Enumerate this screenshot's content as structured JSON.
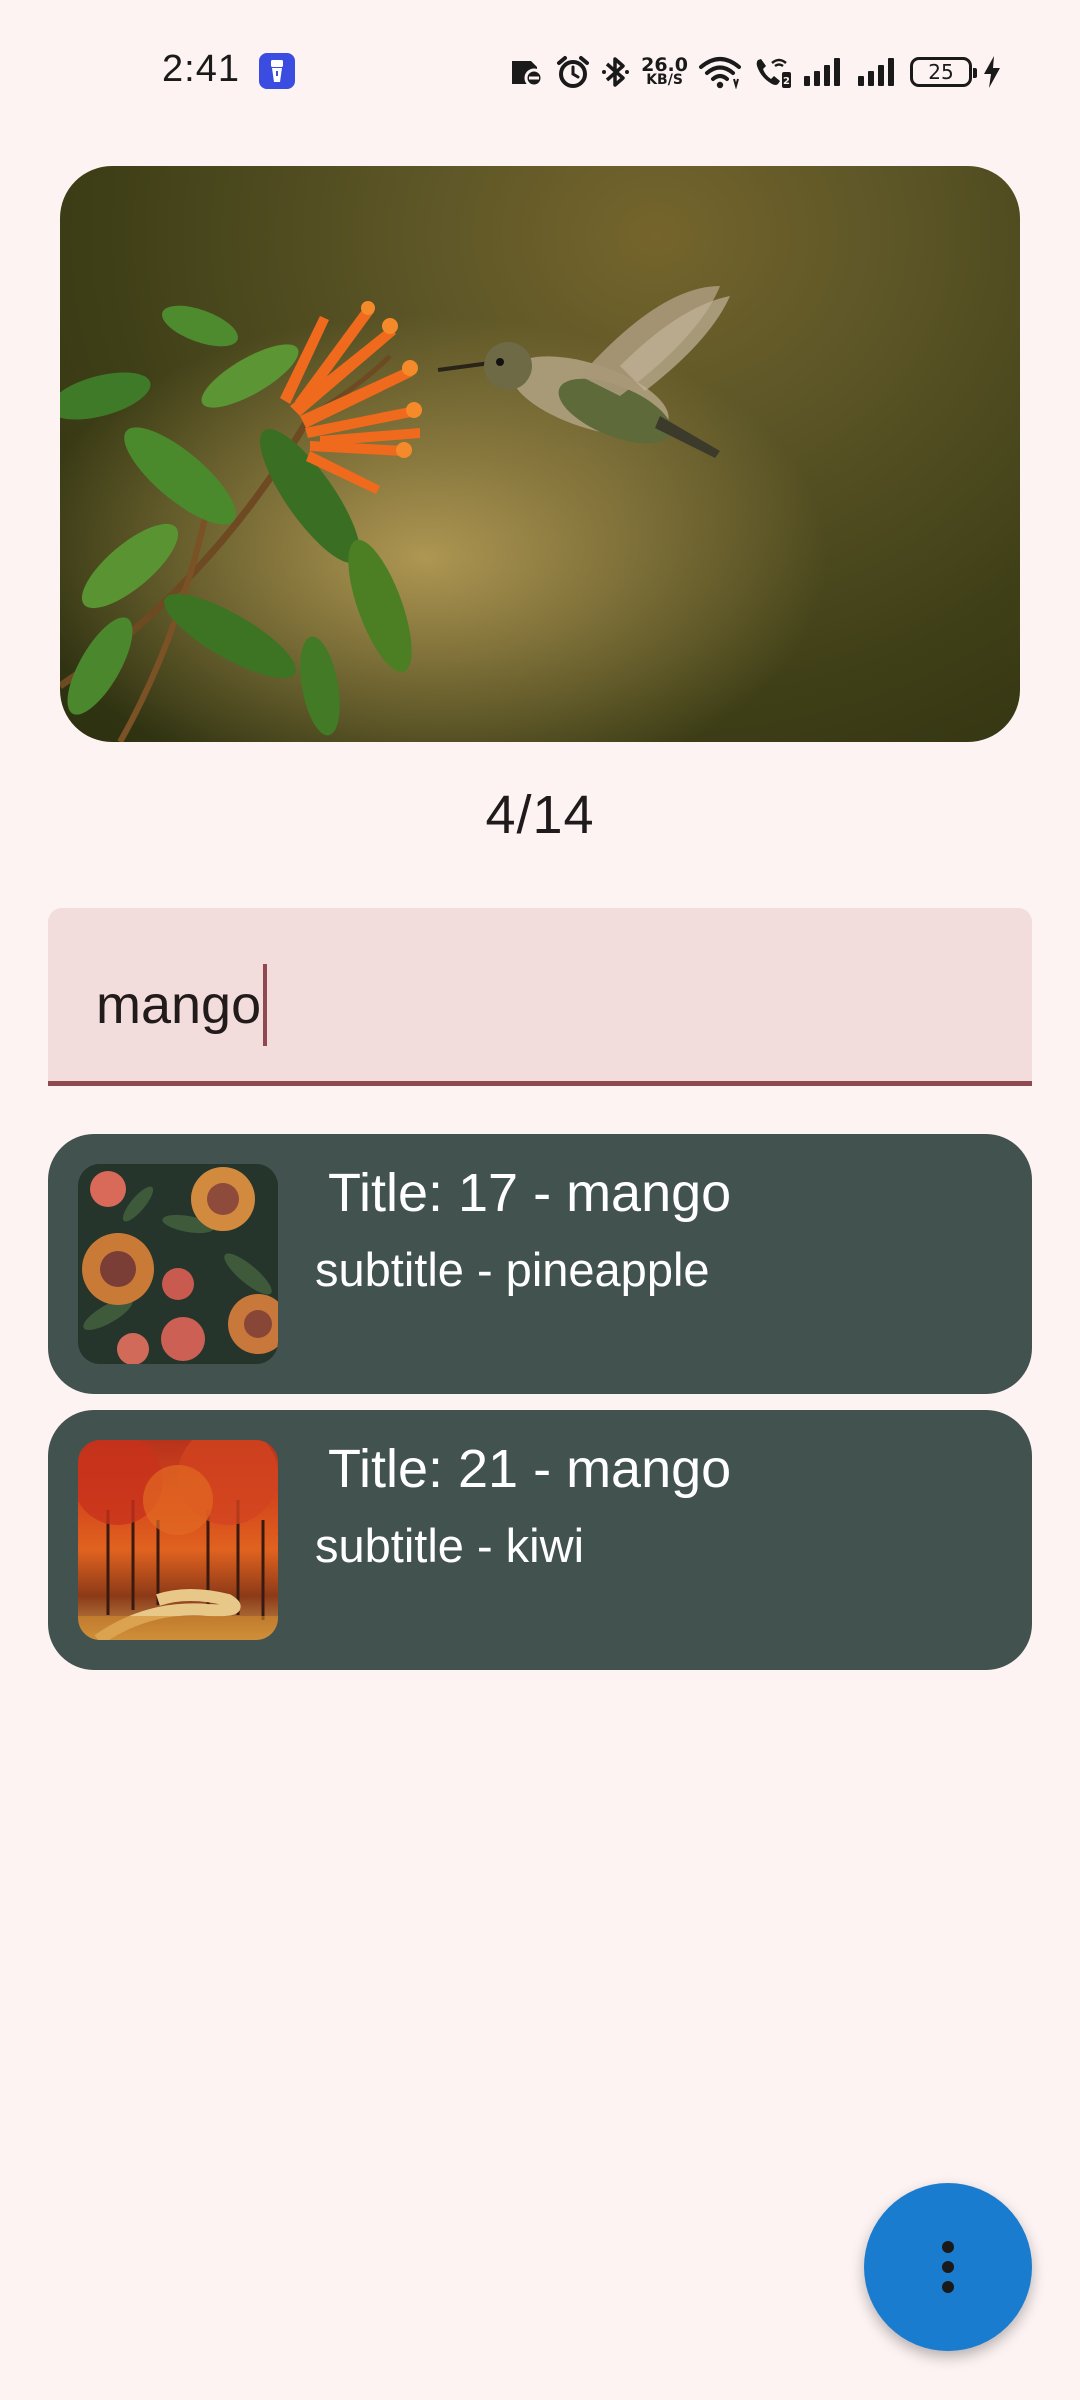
{
  "status_bar": {
    "time": "2:41",
    "net_speed_value": "26.0",
    "net_speed_unit": "KB/S",
    "battery_level": "25",
    "icons": [
      "flashlight-icon",
      "no-sim-card-icon",
      "alarm-icon",
      "bluetooth-icon",
      "wifi-icon",
      "wifi-calling-icon",
      "signal-icon",
      "signal-icon",
      "battery-icon",
      "charging-icon"
    ]
  },
  "gallery": {
    "counter": "4/14"
  },
  "search": {
    "value": "mango"
  },
  "results": [
    {
      "title": " Title: 17 - mango",
      "subtitle": "subtitle - pineapple",
      "thumbnail": "protea-flowers"
    },
    {
      "title": " Title: 21 - mango",
      "subtitle": "subtitle - kiwi",
      "thumbnail": "autumn-forest-path"
    }
  ],
  "fab": {
    "icon": "more-vert-icon"
  },
  "colors": {
    "background": "#fdf3f3",
    "search_fill": "#f3dcdc",
    "accent": "#8e4a50",
    "card": "#42524f",
    "fab": "#1a7ccf"
  }
}
